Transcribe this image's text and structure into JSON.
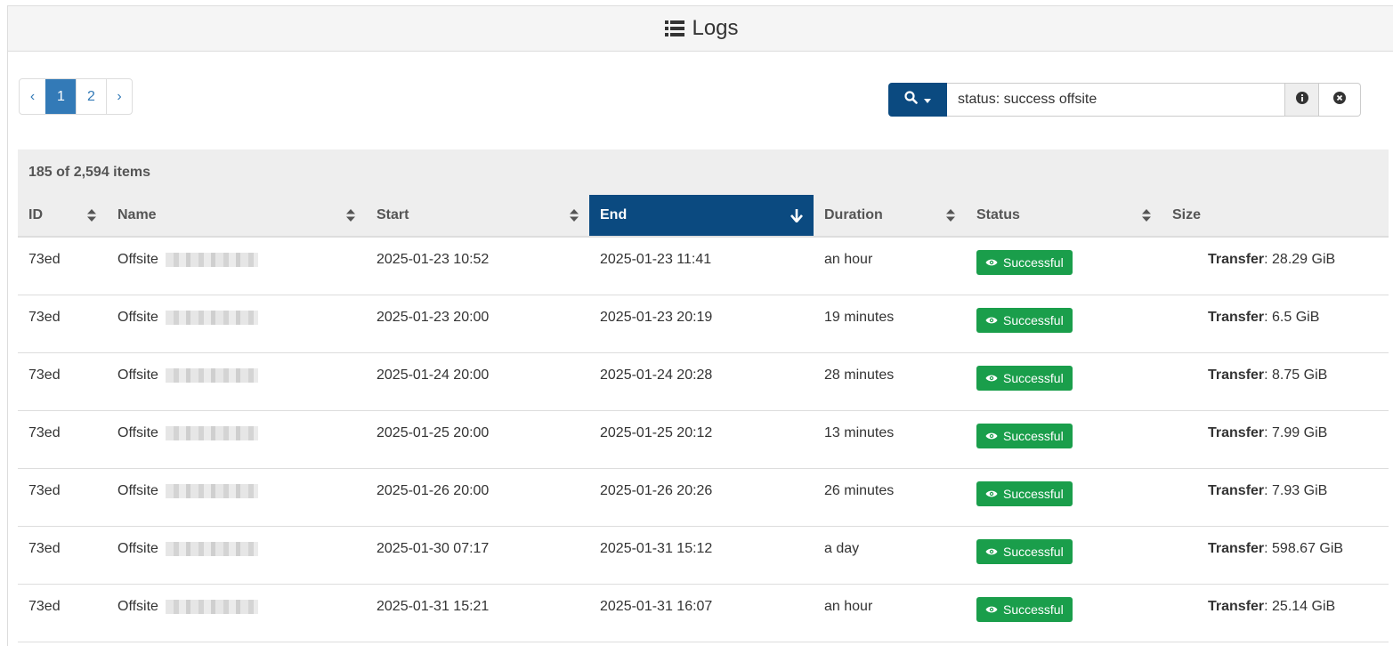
{
  "header": {
    "title": "Logs",
    "icon": "list-icon"
  },
  "pagination": {
    "prev": "‹",
    "pages": [
      "1",
      "2"
    ],
    "active_page": "1",
    "next": "›"
  },
  "search": {
    "value": "status: success offsite",
    "button_icon": "search-icon",
    "info_icon": "info-icon",
    "clear_icon": "clear-icon"
  },
  "table": {
    "count_text": "185 of 2,594 items",
    "columns": [
      "ID",
      "Name",
      "Start",
      "End",
      "Duration",
      "Status",
      "Size"
    ],
    "sorted_column": "End",
    "sorted_direction": "descending",
    "rows": [
      {
        "id": "73ed",
        "name": "Offsite",
        "start": "2025-01-23 10:52",
        "end": "2025-01-23 11:41",
        "duration": "an hour",
        "status": "Successful",
        "size_label": "Transfer",
        "size_value": ": 28.29 GiB"
      },
      {
        "id": "73ed",
        "name": "Offsite",
        "start": "2025-01-23 20:00",
        "end": "2025-01-23 20:19",
        "duration": "19 minutes",
        "status": "Successful",
        "size_label": "Transfer",
        "size_value": ": 6.5 GiB"
      },
      {
        "id": "73ed",
        "name": "Offsite",
        "start": "2025-01-24 20:00",
        "end": "2025-01-24 20:28",
        "duration": "28 minutes",
        "status": "Successful",
        "size_label": "Transfer",
        "size_value": ": 8.75 GiB"
      },
      {
        "id": "73ed",
        "name": "Offsite",
        "start": "2025-01-25 20:00",
        "end": "2025-01-25 20:12",
        "duration": "13 minutes",
        "status": "Successful",
        "size_label": "Transfer",
        "size_value": ": 7.99 GiB"
      },
      {
        "id": "73ed",
        "name": "Offsite",
        "start": "2025-01-26 20:00",
        "end": "2025-01-26 20:26",
        "duration": "26 minutes",
        "status": "Successful",
        "size_label": "Transfer",
        "size_value": ": 7.93 GiB"
      },
      {
        "id": "73ed",
        "name": "Offsite",
        "start": "2025-01-30 07:17",
        "end": "2025-01-31 15:12",
        "duration": "a day",
        "status": "Successful",
        "size_label": "Transfer",
        "size_value": ": 598.67 GiB"
      },
      {
        "id": "73ed",
        "name": "Offsite",
        "start": "2025-01-31 15:21",
        "end": "2025-01-31 16:07",
        "duration": "an hour",
        "status": "Successful",
        "size_label": "Transfer",
        "size_value": ": 25.14 GiB"
      }
    ]
  },
  "colors": {
    "primary": "#0b4a80",
    "active_page": "#337ab7",
    "success": "#1a9e4b",
    "header_bg": "#eeeeee"
  }
}
